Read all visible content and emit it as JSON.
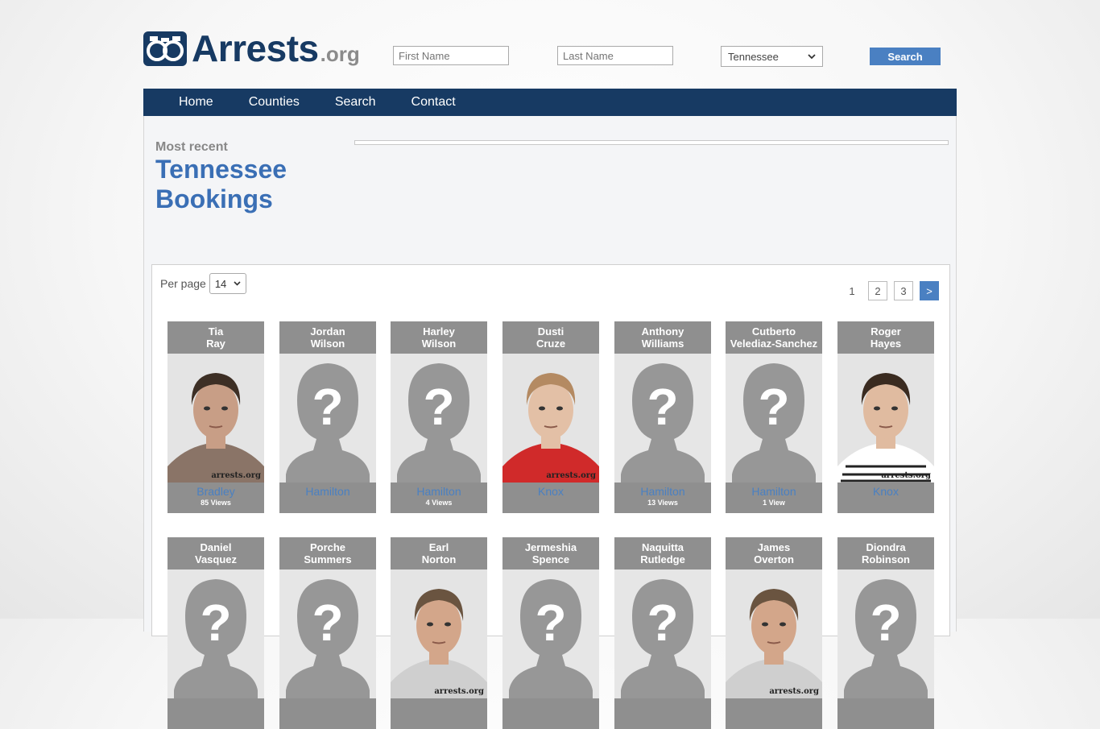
{
  "brand": {
    "name": "Arrests",
    "tld": ".org"
  },
  "search": {
    "first_placeholder": "First Name",
    "last_placeholder": "Last Name",
    "state_selected": "Tennessee",
    "button_label": "Search"
  },
  "nav": [
    "Home",
    "Counties",
    "Search",
    "Contact"
  ],
  "hero": {
    "kicker": "Most recent",
    "title": "Tennessee Bookings"
  },
  "listing": {
    "per_page_label": "Per page",
    "per_page_value": "14",
    "pages": [
      "1",
      "2",
      "3"
    ],
    "next_label": ">"
  },
  "bookings": [
    {
      "first": "Tia",
      "last": "Ray",
      "county": "Bradley",
      "views": "85 Views",
      "photo": "mugshot-female-curly-hair"
    },
    {
      "first": "Jordan",
      "last": "Wilson",
      "county": "Hamilton",
      "views": "",
      "photo": "placeholder"
    },
    {
      "first": "Harley",
      "last": "Wilson",
      "county": "Hamilton",
      "views": "4 Views",
      "photo": "placeholder"
    },
    {
      "first": "Dusti",
      "last": "Cruze",
      "county": "Knox",
      "views": "",
      "photo": "mugshot-female-red-shirt"
    },
    {
      "first": "Anthony",
      "last": "Williams",
      "county": "Hamilton",
      "views": "13 Views",
      "photo": "placeholder"
    },
    {
      "first": "Cutberto",
      "last": "Velediaz-Sanchez",
      "county": "Hamilton",
      "views": "1 View",
      "photo": "placeholder"
    },
    {
      "first": "Roger",
      "last": "Hayes",
      "county": "Knox",
      "views": "",
      "photo": "mugshot-male-striped"
    },
    {
      "first": "Daniel",
      "last": "Vasquez",
      "county": "",
      "views": "",
      "photo": "placeholder"
    },
    {
      "first": "Porche",
      "last": "Summers",
      "county": "",
      "views": "",
      "photo": "placeholder"
    },
    {
      "first": "Earl",
      "last": "Norton",
      "county": "",
      "views": "",
      "photo": "mugshot-male"
    },
    {
      "first": "Jermeshia",
      "last": "Spence",
      "county": "",
      "views": "",
      "photo": "placeholder"
    },
    {
      "first": "Naquitta",
      "last": "Rutledge",
      "county": "",
      "views": "",
      "photo": "placeholder"
    },
    {
      "first": "James",
      "last": "Overton",
      "county": "",
      "views": "",
      "photo": "mugshot-male"
    },
    {
      "first": "Diondra",
      "last": "Robinson",
      "county": "",
      "views": "",
      "photo": "placeholder"
    }
  ],
  "watermark": "arrests.org"
}
